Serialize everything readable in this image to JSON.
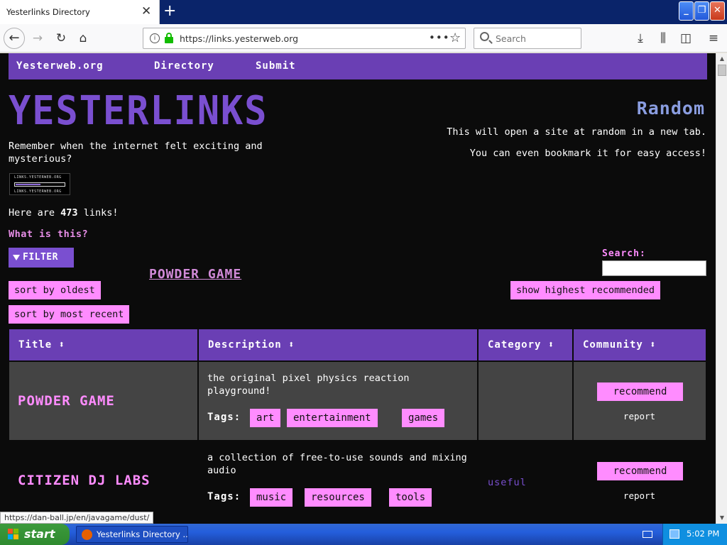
{
  "browser": {
    "tab_title": "Yesterlinks Directory",
    "url": "https://links.yesterweb.org",
    "search_placeholder": "Search",
    "status_url": "https://dan-ball.jp/en/javagame/dust/"
  },
  "site": {
    "nav": [
      "Yesterweb.org",
      "Directory",
      "Submit"
    ],
    "logo": "YESTERLINKS",
    "tagline": "Remember when the internet felt exciting and mysterious?",
    "badge_text": "LINKS.YESTERWEB.ORG",
    "badge_fill": 0.5,
    "count_prefix": "Here are",
    "count_value": "473",
    "count_suffix": "links!",
    "what_is_this": "What is this?",
    "random": {
      "title": "Random",
      "line1": "This will open a site at random in a new tab.",
      "line2": "You can even bookmark it for easy access!"
    },
    "filter_label": "FILTER",
    "featured_link": "POWDER GAME",
    "sort_oldest": "sort by oldest",
    "sort_recent": "sort by most recent",
    "show_recommended": "show highest recommended",
    "search_label": "Search:",
    "search_value": ""
  },
  "table": {
    "headers": [
      "Title ⬍",
      "Description ⬍",
      "Category ⬍",
      "Community ⬍"
    ],
    "tags_label": "Tags:",
    "recommend_label": "recommend",
    "report_label": "report",
    "rows": [
      {
        "title": "POWDER GAME",
        "description": "the original pixel physics reaction playground!",
        "tags": [
          "art",
          "entertainment",
          "games"
        ],
        "category": ""
      },
      {
        "title": "CITIZEN DJ LABS",
        "description": "a collection of free-to-use sounds and mixing audio",
        "tags": [
          "music",
          "resources",
          "tools"
        ],
        "category": "useful"
      }
    ]
  },
  "taskbar": {
    "start_label": "start",
    "task_label": "Yesterlinks Directory ...",
    "clock": "5:02 PM"
  },
  "colors": {
    "accent_purple": "#6a3fb4",
    "pink": "#ff8cff",
    "page_bg": "#0b0b0b",
    "row_alt": "#444444"
  }
}
